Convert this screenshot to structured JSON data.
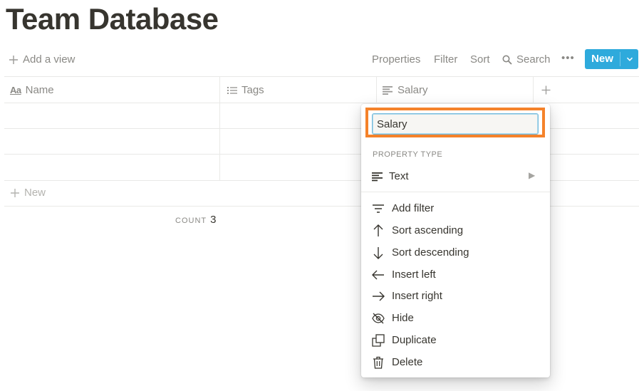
{
  "page": {
    "title": "Team Database"
  },
  "toolbar": {
    "add_view": "Add a view",
    "properties": "Properties",
    "filter": "Filter",
    "sort": "Sort",
    "search": "Search",
    "more": "•••",
    "new_button": "New"
  },
  "table": {
    "columns": [
      {
        "label": "Name",
        "icon": "text-aa-icon"
      },
      {
        "label": "Tags",
        "icon": "list-icon"
      },
      {
        "label": "Salary",
        "icon": "text-lines-icon"
      }
    ],
    "rows": [
      {},
      {},
      {}
    ],
    "new_row": "New",
    "count_label": "COUNT",
    "count_value": "3"
  },
  "property_menu": {
    "name_value": "Salary",
    "section_label": "PROPERTY TYPE",
    "type_label": "Text",
    "items": [
      {
        "label": "Add filter",
        "icon": "filter-icon"
      },
      {
        "label": "Sort ascending",
        "icon": "arrow-up-icon"
      },
      {
        "label": "Sort descending",
        "icon": "arrow-down-icon"
      },
      {
        "label": "Insert left",
        "icon": "arrow-left-icon"
      },
      {
        "label": "Insert right",
        "icon": "arrow-right-icon"
      },
      {
        "label": "Hide",
        "icon": "eye-slash-icon"
      },
      {
        "label": "Duplicate",
        "icon": "duplicate-icon"
      },
      {
        "label": "Delete",
        "icon": "trash-icon"
      }
    ]
  },
  "colors": {
    "accent": "#2eaadc",
    "highlight": "#f5822a",
    "text": "#37352f",
    "muted": "#8a8985"
  }
}
